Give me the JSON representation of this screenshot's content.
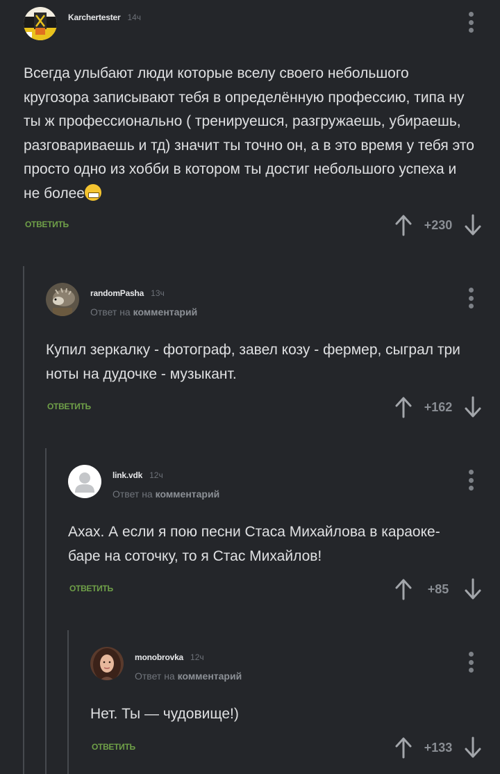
{
  "comments": [
    {
      "username": "Karchertester",
      "time": "14ч",
      "reply_prefix": "",
      "reply_target": "",
      "body": "Всегда улыбают люди которые вселу своего небольшого кругозора записывают тебя в определённую профессию, типа ну ты ж профессионально ( тренируешся, разгружаешь, убираешь, разговариваешь и тд) значит ты точно он, а в это время у тебя это просто одно из хобби в котором ты достиг небольшого успеха и не более",
      "emoji": "grinning-face-emoji",
      "reply_label": "ОТВЕТИТЬ",
      "score": "+230",
      "avatar": "karchertester-avatar"
    },
    {
      "username": "randomPasha",
      "time": "13ч",
      "reply_prefix": "Ответ на",
      "reply_target": "комментарий",
      "body": "Купил зеркалку - фотограф, завел козу - фермер, сыграл три ноты на дудочке - музыкант.",
      "reply_label": "ОТВЕТИТЬ",
      "score": "+162",
      "avatar": "hedgehog-avatar"
    },
    {
      "username": "link.vdk",
      "time": "12ч",
      "reply_prefix": "Ответ на",
      "reply_target": "комментарий",
      "body": "Ахах. А если я пою песни Стаса Михайлова в караоке-баре на соточку, то я Стас Михайлов!",
      "reply_label": "ОТВЕТИТЬ",
      "score": "+85",
      "avatar": "default-user-avatar"
    },
    {
      "username": "monobrovka",
      "time": "12ч",
      "reply_prefix": "Ответ на",
      "reply_target": "комментарий",
      "body": "Нет. Ты — чудовище!)",
      "reply_label": "ОТВЕТИТЬ",
      "score": "+133",
      "avatar": "woman-photo-avatar"
    }
  ],
  "icons": {
    "more": "more-vertical-icon",
    "upvote": "arrow-up-icon",
    "downvote": "arrow-down-icon"
  },
  "colors": {
    "background": "#24262a",
    "accent_green": "#6fa048",
    "text": "#dfe0e2",
    "muted": "#8a8e94"
  }
}
